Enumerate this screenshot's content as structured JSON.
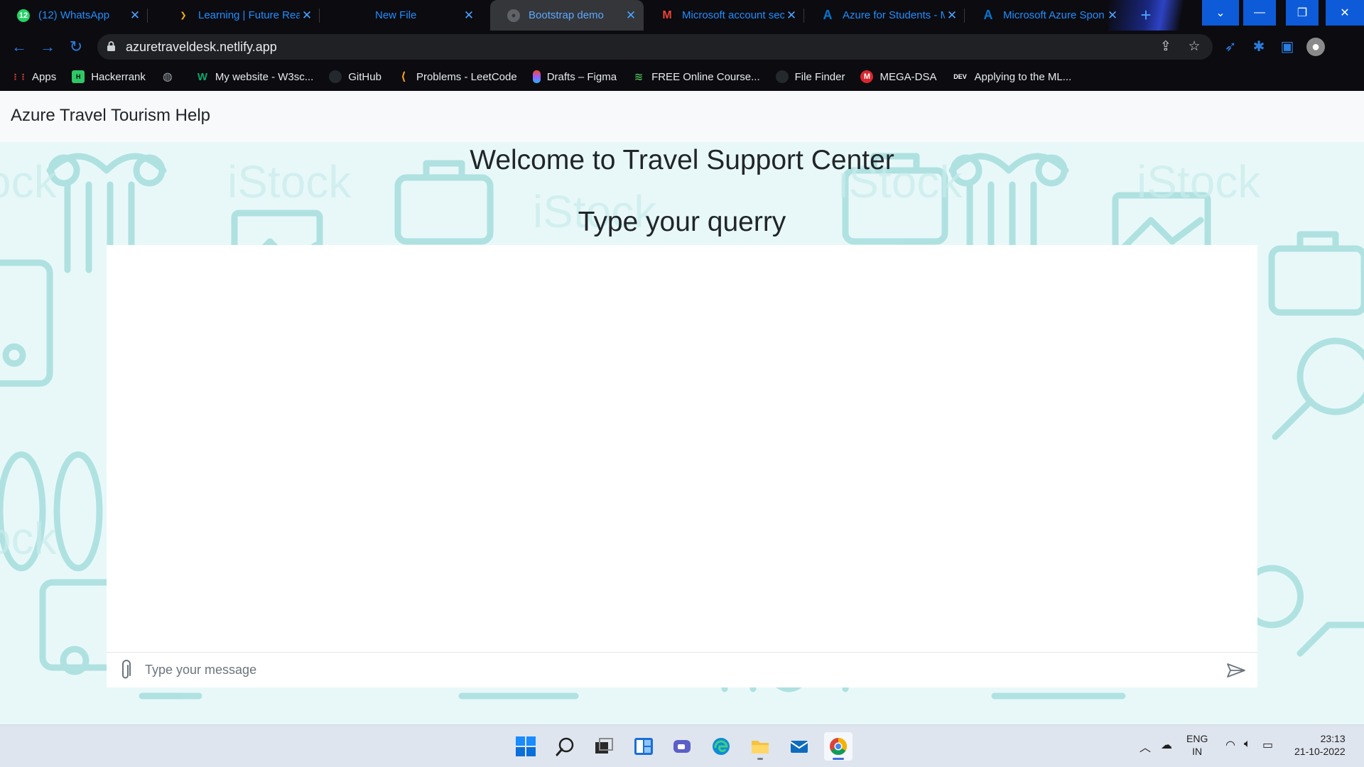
{
  "browser": {
    "tabs": [
      {
        "title": "(12) WhatsApp",
        "favicon": "whatsapp-icon",
        "fav_color": "#25d366"
      },
      {
        "title": "Learning | Future Read",
        "favicon": "future-ready-icon",
        "fav_color": "#f5b400"
      },
      {
        "title": "New File",
        "favicon": "",
        "fav_color": ""
      },
      {
        "title": "Bootstrap demo",
        "favicon": "globe-icon",
        "fav_color": "#5f6368",
        "active": true
      },
      {
        "title": "Microsoft account sec",
        "favicon": "gmail-icon",
        "fav_color": "#ea4335"
      },
      {
        "title": "Azure for Students - M",
        "favicon": "azure-icon",
        "fav_color": "#0078d4"
      },
      {
        "title": "Microsoft Azure Spon",
        "favicon": "azure-icon",
        "fav_color": "#0078d4"
      }
    ],
    "address": "azuretraveldesk.netlify.app",
    "bookmarks": [
      {
        "label": "Apps",
        "icon": "apps-grid-icon",
        "color": "#ea4335"
      },
      {
        "label": "Hackerrank",
        "icon": "hackerrank-icon",
        "color": "#2ec866"
      },
      {
        "label": "",
        "icon": "globe-icon",
        "color": "#9aa0a6"
      },
      {
        "label": "My website - W3sc...",
        "icon": "w3schools-icon",
        "color": "#04aa6d"
      },
      {
        "label": "GitHub",
        "icon": "github-icon",
        "color": "#24292e"
      },
      {
        "label": "Problems - LeetCode",
        "icon": "leetcode-icon",
        "color": "#ffa116"
      },
      {
        "label": "Drafts – Figma",
        "icon": "figma-icon",
        "color": "#f24e1e"
      },
      {
        "label": "FREE Online Course...",
        "icon": "course-icon",
        "color": "#4caf50"
      },
      {
        "label": "File Finder",
        "icon": "github-icon",
        "color": "#24292e"
      },
      {
        "label": "MEGA-DSA",
        "icon": "mega-icon",
        "color": "#d9272e"
      },
      {
        "label": "Applying to the ML...",
        "icon": "dev-icon",
        "color": "#000000"
      }
    ]
  },
  "site": {
    "brand": "Azure Travel Tourism Help",
    "welcome": "Welcome to Travel Support Center",
    "prompt": "Type your querry",
    "message_placeholder": "Type your message"
  },
  "taskbar": {
    "apps": [
      "windows-start-icon",
      "search-icon",
      "task-view-icon",
      "widgets-icon",
      "teams-chat-icon",
      "edge-icon",
      "file-explorer-icon",
      "mail-icon",
      "chrome-icon"
    ],
    "lang_top": "ENG",
    "lang_bottom": "IN",
    "time": "23:13",
    "date": "21-10-2022"
  },
  "colors": {
    "accent": "#1e8fff",
    "page_bg": "#e8f8f8",
    "pattern": "#a6dede",
    "taskbar": "#dfe5ee"
  }
}
